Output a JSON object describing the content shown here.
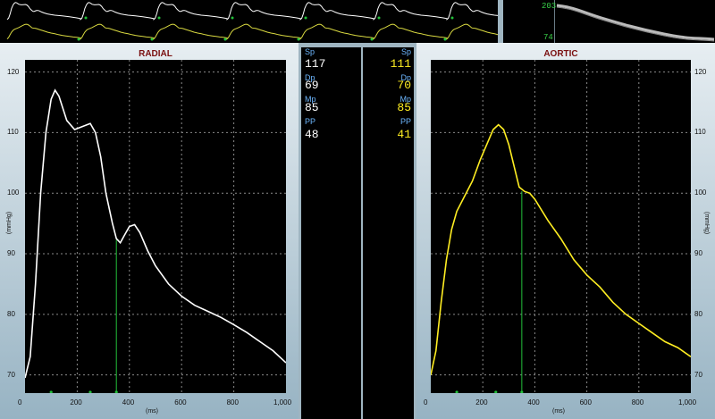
{
  "radial": {
    "title": "RADIAL",
    "y_ticks": [
      "120",
      "110",
      "100",
      "90",
      "80",
      "70"
    ],
    "x_ticks": [
      "0",
      "200",
      "400",
      "600",
      "800",
      "1,000"
    ],
    "x_unit": "(ms)",
    "y_unit": "(mmHg)"
  },
  "aortic": {
    "title": "AORTIC",
    "y_ticks": [
      "120",
      "110",
      "100",
      "90",
      "80",
      "70"
    ],
    "x_ticks": [
      "0",
      "200",
      "400",
      "600",
      "800",
      "1,000"
    ],
    "x_unit": "(ms)",
    "y_unit": "(mmHg)"
  },
  "radial_values": {
    "sp_label": "Sp",
    "sp": "117",
    "dp_label": "Dp",
    "dp": "69",
    "mp_label": "Mp",
    "mp": "85",
    "pp_label": "PP",
    "pp": "48"
  },
  "aortic_values": {
    "sp_label": "Sp",
    "sp": "111",
    "dp_label": "Dp",
    "dp": "70",
    "mp_label": "Mp",
    "mp": "85",
    "pp_label": "PP",
    "pp": "41"
  },
  "trend": {
    "top": "203",
    "bottom": "74"
  },
  "colors": {
    "radial_line": "#ffffff",
    "aortic_line": "#ffee22",
    "marker": "#22c03a",
    "value_aortic": "#ffee22",
    "value_radial": "#ffffff",
    "label": "#6db7ff"
  },
  "chart_data": [
    {
      "type": "line",
      "title": "RADIAL",
      "xlabel": "(ms)",
      "ylabel": "(mmHg)",
      "xlim": [
        0,
        1000
      ],
      "ylim": [
        67,
        122
      ],
      "x": [
        0,
        20,
        40,
        60,
        80,
        100,
        115,
        130,
        160,
        190,
        220,
        250,
        270,
        290,
        310,
        335,
        350,
        365,
        380,
        400,
        420,
        440,
        470,
        500,
        550,
        600,
        650,
        700,
        750,
        800,
        850,
        900,
        950,
        1000
      ],
      "series": [
        {
          "values": [
            69.5,
            73,
            85,
            100,
            110,
            115.5,
            117,
            116,
            112,
            110.5,
            111,
            111.5,
            110,
            106,
            100,
            95,
            92.5,
            91.8,
            93,
            94.5,
            94.8,
            93.5,
            90.5,
            88,
            85,
            83,
            81.5,
            80.5,
            79.5,
            78.3,
            77,
            75.5,
            74,
            72
          ]
        }
      ],
      "grid": true
    },
    {
      "type": "line",
      "title": "AORTIC",
      "xlabel": "(ms)",
      "ylabel": "(mmHg)",
      "xlim": [
        0,
        1000
      ],
      "ylim": [
        67,
        122
      ],
      "x": [
        0,
        20,
        40,
        60,
        80,
        100,
        130,
        160,
        190,
        220,
        240,
        260,
        280,
        300,
        320,
        340,
        360,
        380,
        400,
        450,
        500,
        550,
        600,
        650,
        700,
        750,
        800,
        850,
        900,
        950,
        1000
      ],
      "series": [
        {
          "values": [
            70,
            74,
            82,
            89,
            94,
            97,
            99.5,
            102,
            105.5,
            108.5,
            110.5,
            111.3,
            110.5,
            108,
            104.5,
            101,
            100.3,
            100,
            99,
            95.5,
            92.5,
            89,
            86.5,
            84.5,
            82,
            80,
            78.5,
            77,
            75.5,
            74.5,
            73
          ]
        }
      ],
      "grid": true
    }
  ]
}
